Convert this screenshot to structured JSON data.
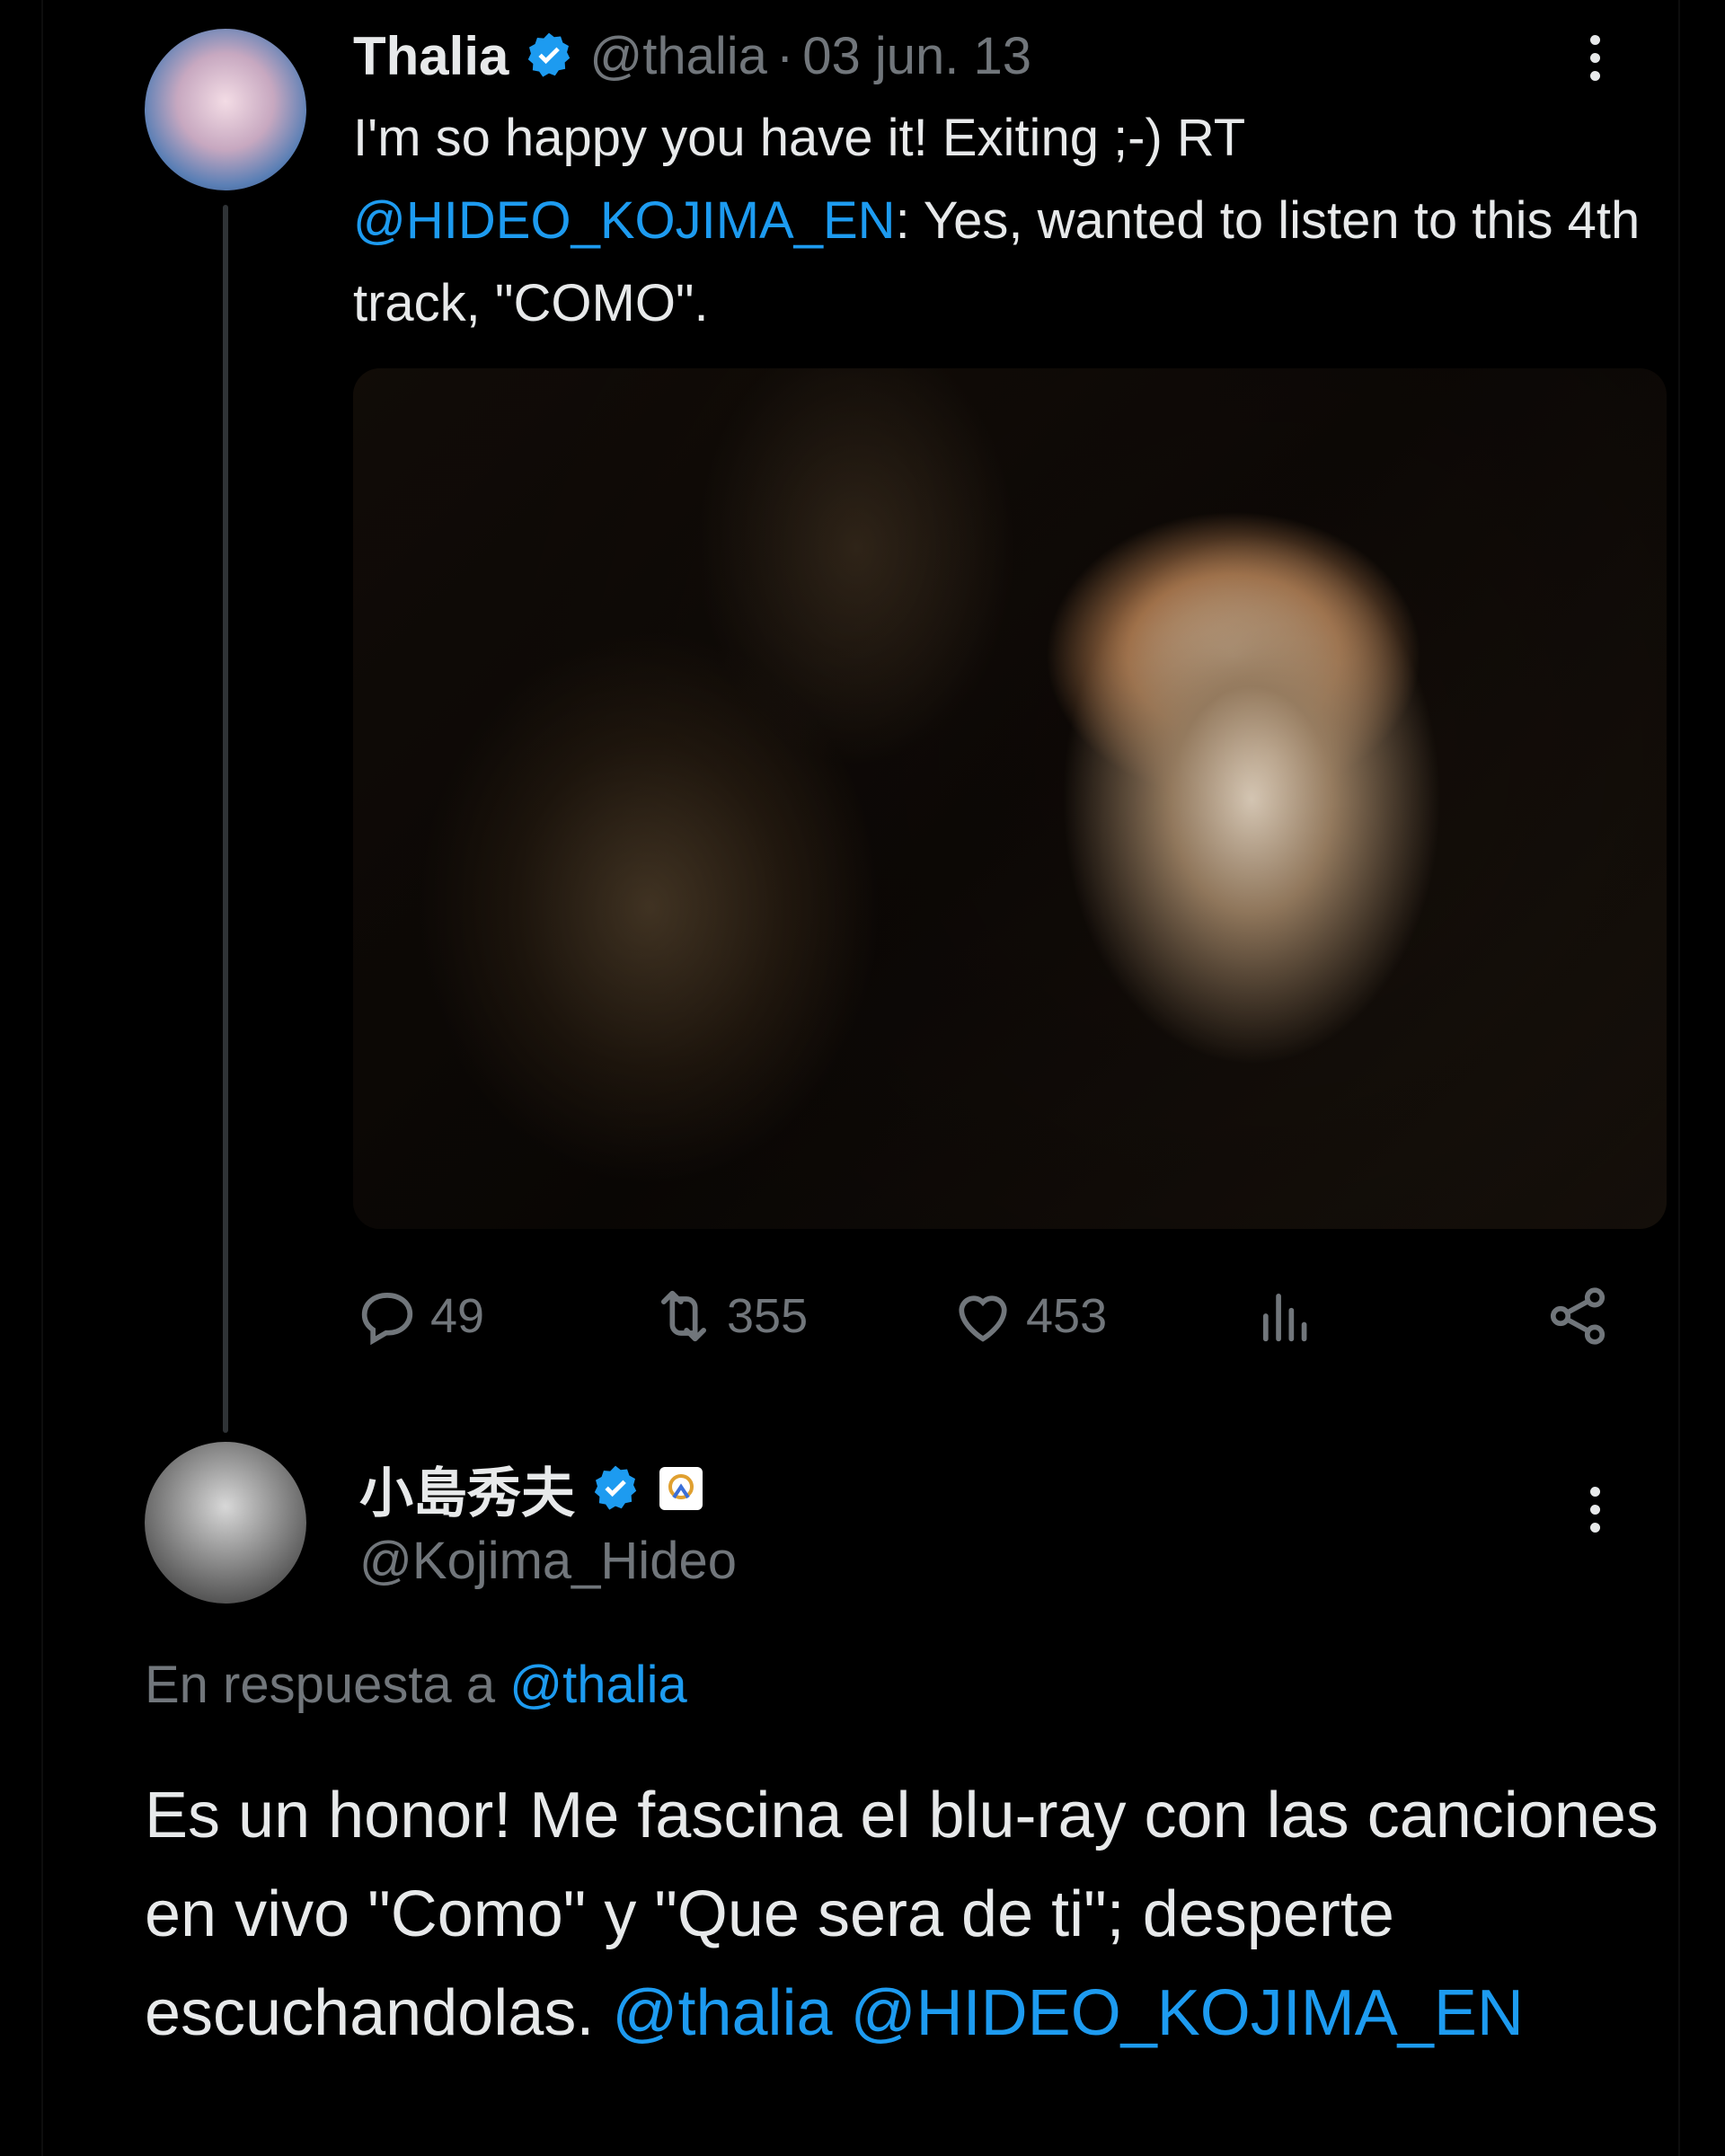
{
  "tweet1": {
    "display_name": "Thalia",
    "handle": "@thalia",
    "separator": "·",
    "date": "03 jun. 13",
    "text_part1": "I'm so happy you have it! Exiting ;-) RT",
    "mention": "@HIDEO_KOJIMA_EN",
    "text_part2": ": Yes, wanted to listen to this 4th track, \"COMO\".",
    "actions": {
      "replies": "49",
      "retweets": "355",
      "likes": "453"
    }
  },
  "tweet2": {
    "display_name": "小島秀夫",
    "handle": "@Kojima_Hideo",
    "reply_prefix": "En respuesta a",
    "reply_mention": "@thalia",
    "text": "Es un honor! Me fascina el blu-ray con las canciones en vivo \"Como\" y \"Que sera de ti\"; desperte escuchandolas.",
    "mention1": "@thalia",
    "mention2": "@HIDEO_KOJIMA_EN"
  },
  "colors": {
    "background": "#000000",
    "text": "#e7e9ea",
    "muted": "#71767b",
    "link": "#1d9bf0",
    "verified": "#1d9bf0"
  },
  "icons": [
    "verified-badge-icon",
    "more-options-icon",
    "reply-icon",
    "retweet-icon",
    "like-icon",
    "views-icon",
    "share-icon",
    "affiliate-badge-icon"
  ]
}
